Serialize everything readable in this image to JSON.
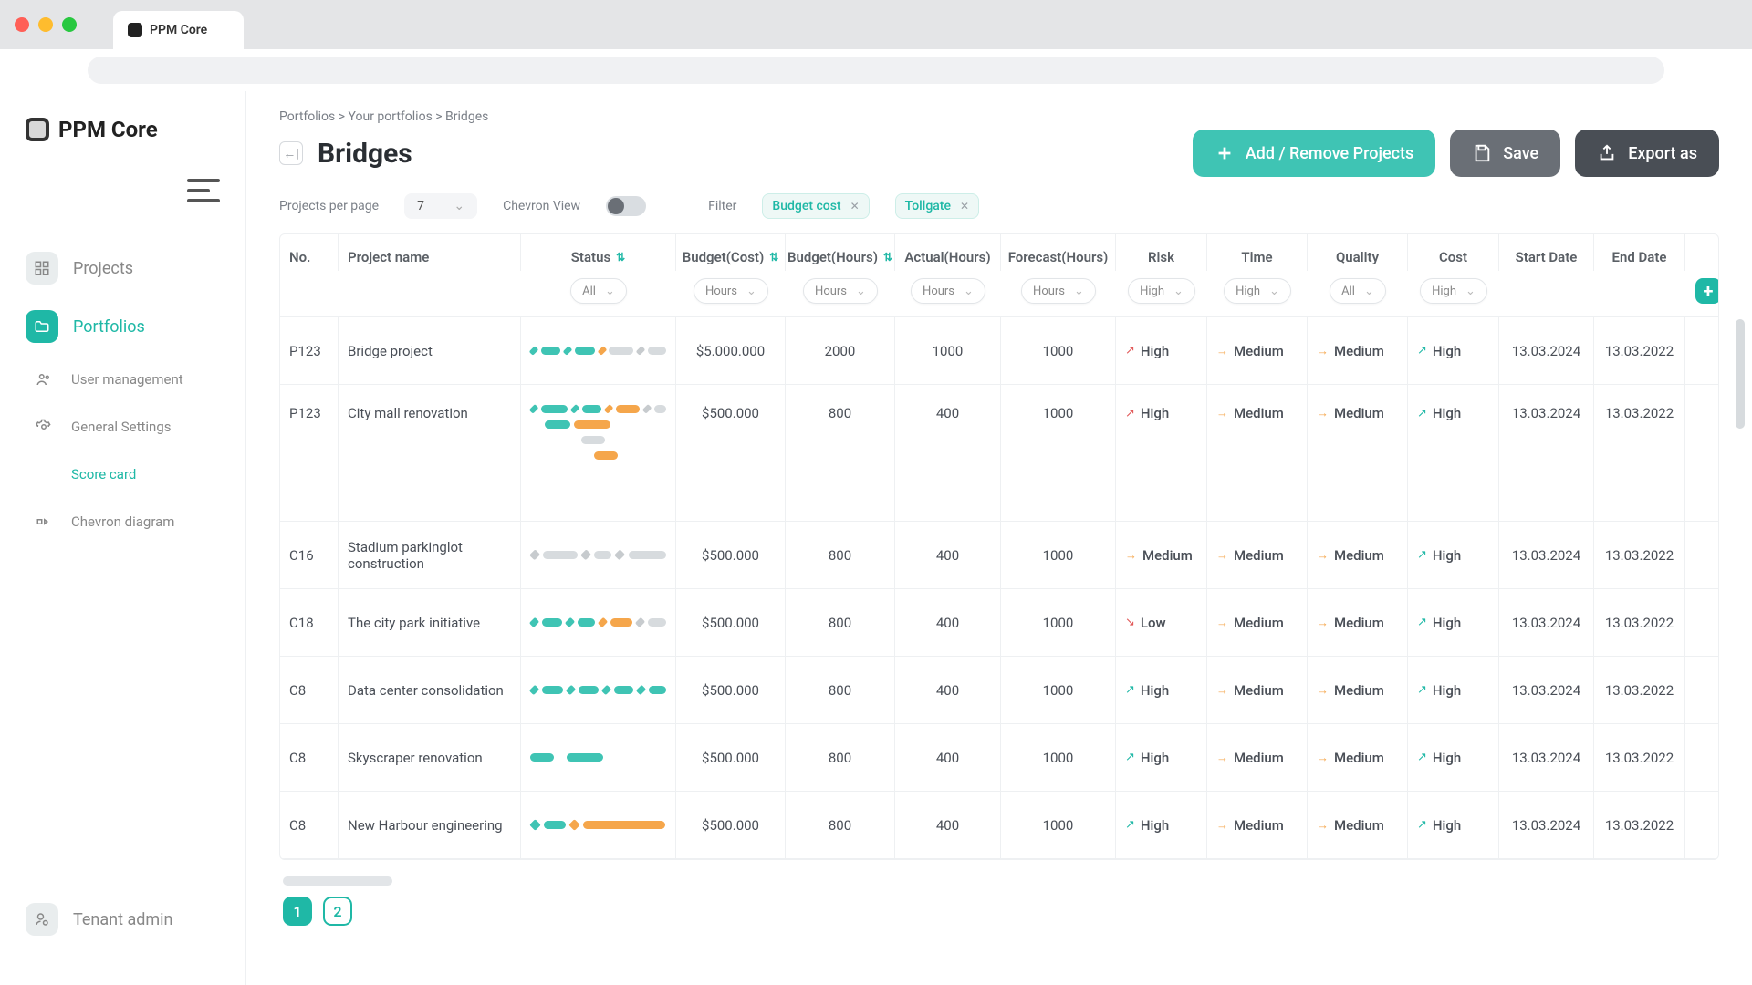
{
  "tab_title": "PPM Core",
  "logo_text": "PPM Core",
  "sidebar": {
    "items": [
      {
        "label": "Projects"
      },
      {
        "label": "Portfolios"
      },
      {
        "label": "User management"
      },
      {
        "label": "General Settings"
      },
      {
        "label": "Score card"
      },
      {
        "label": "Chevron diagram"
      }
    ],
    "bottom": {
      "label": "Tenant admin"
    }
  },
  "breadcrumbs": "Portfolios > Your portfolios > Bridges",
  "page_title": "Bridges",
  "actions": {
    "add_remove": "Add / Remove Projects",
    "save": "Save",
    "export": "Export as"
  },
  "tools": {
    "per_page_label": "Projects per page",
    "per_page_value": "7",
    "chevron_label": "Chevron View",
    "filter_label": "Filter",
    "filter_chips": [
      "Budget cost",
      "Tollgate"
    ]
  },
  "columns": {
    "no": "No.",
    "name": "Project name",
    "status": "Status",
    "budget_cost": "Budget(Cost)",
    "budget_hours": "Budget(Hours)",
    "actual_hours": "Actual(Hours)",
    "forecast_hours": "Forecast(Hours)",
    "risk": "Risk",
    "time": "Time",
    "quality": "Quality",
    "cost": "Cost",
    "start": "Start Date",
    "end": "End Date"
  },
  "sub_filters": {
    "status": "All",
    "budget_cost": "Hours",
    "budget_hours": "Hours",
    "actual_hours": "Hours",
    "forecast_hours": "Hours",
    "risk": "High",
    "time": "High",
    "quality": "All",
    "cost": "High"
  },
  "rows": [
    {
      "no": "P123",
      "name": "Bridge project",
      "budget_cost": "$5.000.000",
      "budget_hours": "2000",
      "actual": "1000",
      "forecast": "1000",
      "risk": {
        "lvl": "High",
        "dir": "upred"
      },
      "time": {
        "lvl": "Medium",
        "dir": "rt"
      },
      "quality": {
        "lvl": "Medium",
        "dir": "rt"
      },
      "cost": {
        "lvl": "High",
        "dir": "up"
      },
      "start": "13.03.2024",
      "end": "13.03.2022"
    },
    {
      "no": "P123",
      "name": "City mall renovation",
      "budget_cost": "$500.000",
      "budget_hours": "800",
      "actual": "400",
      "forecast": "1000",
      "risk": {
        "lvl": "High",
        "dir": "upred"
      },
      "time": {
        "lvl": "Medium",
        "dir": "rt"
      },
      "quality": {
        "lvl": "Medium",
        "dir": "rt"
      },
      "cost": {
        "lvl": "High",
        "dir": "up"
      },
      "start": "13.03.2024",
      "end": "13.03.2022"
    },
    {
      "no": "C16",
      "name": "Stadium parkinglot construction",
      "budget_cost": "$500.000",
      "budget_hours": "800",
      "actual": "400",
      "forecast": "1000",
      "risk": {
        "lvl": "Medium",
        "dir": "rt"
      },
      "time": {
        "lvl": "Medium",
        "dir": "rt"
      },
      "quality": {
        "lvl": "Medium",
        "dir": "rt"
      },
      "cost": {
        "lvl": "High",
        "dir": "up"
      },
      "start": "13.03.2024",
      "end": "13.03.2022"
    },
    {
      "no": "C18",
      "name": "The city park initiative",
      "budget_cost": "$500.000",
      "budget_hours": "800",
      "actual": "400",
      "forecast": "1000",
      "risk": {
        "lvl": "Low",
        "dir": "dn"
      },
      "time": {
        "lvl": "Medium",
        "dir": "rt"
      },
      "quality": {
        "lvl": "Medium",
        "dir": "rt"
      },
      "cost": {
        "lvl": "High",
        "dir": "up"
      },
      "start": "13.03.2024",
      "end": "13.03.2022"
    },
    {
      "no": "C8",
      "name": "Data center consolidation",
      "budget_cost": "$500.000",
      "budget_hours": "800",
      "actual": "400",
      "forecast": "1000",
      "risk": {
        "lvl": "High",
        "dir": "up"
      },
      "time": {
        "lvl": "Medium",
        "dir": "rt"
      },
      "quality": {
        "lvl": "Medium",
        "dir": "rt"
      },
      "cost": {
        "lvl": "High",
        "dir": "up"
      },
      "start": "13.03.2024",
      "end": "13.03.2022"
    },
    {
      "no": "C8",
      "name": "Skyscraper renovation",
      "budget_cost": "$500.000",
      "budget_hours": "800",
      "actual": "400",
      "forecast": "1000",
      "risk": {
        "lvl": "High",
        "dir": "up"
      },
      "time": {
        "lvl": "Medium",
        "dir": "rt"
      },
      "quality": {
        "lvl": "Medium",
        "dir": "rt"
      },
      "cost": {
        "lvl": "High",
        "dir": "up"
      },
      "start": "13.03.2024",
      "end": "13.03.2022"
    },
    {
      "no": "C8",
      "name": "New Harbour engineering",
      "budget_cost": "$500.000",
      "budget_hours": "800",
      "actual": "400",
      "forecast": "1000",
      "risk": {
        "lvl": "High",
        "dir": "up"
      },
      "time": {
        "lvl": "Medium",
        "dir": "rt"
      },
      "quality": {
        "lvl": "Medium",
        "dir": "rt"
      },
      "cost": {
        "lvl": "High",
        "dir": "up"
      },
      "start": "13.03.2024",
      "end": "13.03.2022"
    }
  ],
  "pages": [
    "1",
    "2"
  ]
}
